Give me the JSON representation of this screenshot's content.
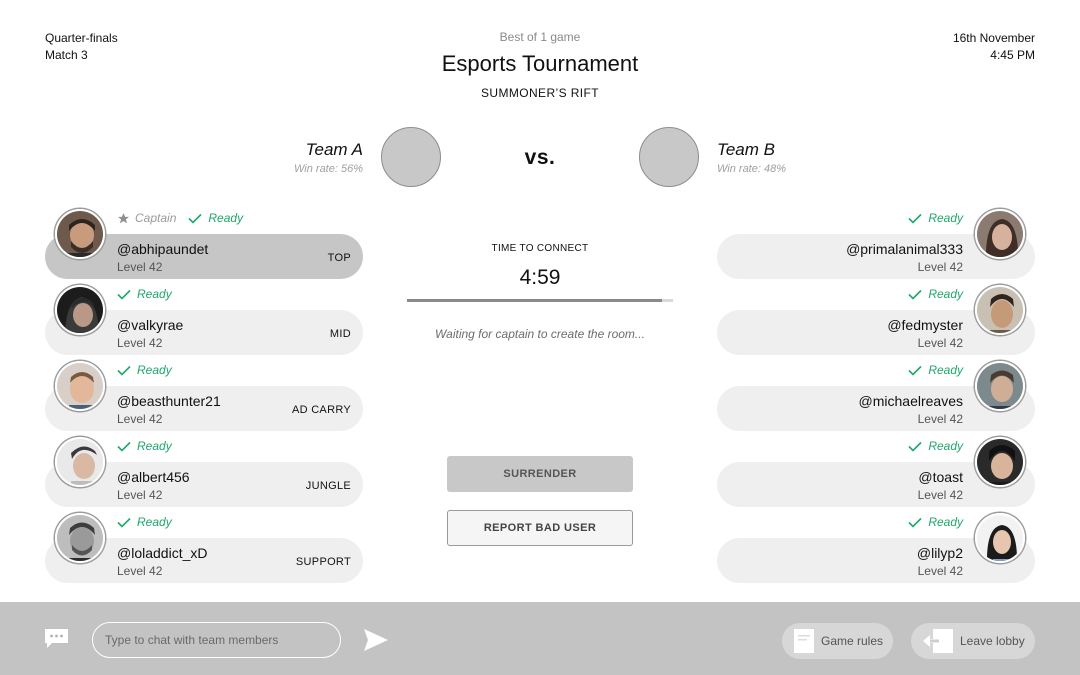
{
  "match": {
    "stage": "Quarter-finals",
    "match_number": "Match 3"
  },
  "header": {
    "format": "Best of 1 game",
    "title": "Esports Tournament",
    "map": "SUMMONER’S RIFT"
  },
  "schedule": {
    "date": "16th November",
    "time": "4:45 PM"
  },
  "versus": "vs.",
  "team_a": {
    "name": "Team A",
    "win_rate": "Win rate: 56%"
  },
  "team_b": {
    "name": "Team B",
    "win_rate": "Win rate: 48%"
  },
  "team_a_players": [
    {
      "captain_label": "Captain",
      "status": "Ready",
      "handle": "@abhipaundet",
      "level": "Level 42",
      "role": "TOP",
      "active": true
    },
    {
      "status": "Ready",
      "handle": "@valkyrae",
      "level": "Level 42",
      "role": "MID"
    },
    {
      "status": "Ready",
      "handle": "@beasthunter21",
      "level": "Level 42",
      "role": "AD CARRY"
    },
    {
      "status": "Ready",
      "handle": "@albert456",
      "level": "Level 42",
      "role": "JUNGLE"
    },
    {
      "status": "Ready",
      "handle": "@loladdict_xD",
      "level": "Level 42",
      "role": "SUPPORT"
    }
  ],
  "team_b_players": [
    {
      "status": "Ready",
      "handle": "@primalanimal333",
      "level": "Level 42"
    },
    {
      "status": "Ready",
      "handle": "@fedmyster",
      "level": "Level 42"
    },
    {
      "status": "Ready",
      "handle": "@michaelreaves",
      "level": "Level 42"
    },
    {
      "status": "Ready",
      "handle": "@toast",
      "level": "Level 42"
    },
    {
      "status": "Ready",
      "handle": "@lilyp2",
      "level": "Level 42"
    }
  ],
  "connect": {
    "label": "TIME TO CONNECT",
    "timer": "4:59",
    "progress": 0.96,
    "waiting": "Waiting for captain to create the room..."
  },
  "actions": {
    "surrender": "SURRENDER",
    "report": "REPORT BAD USER"
  },
  "footer": {
    "chat_placeholder": "Type to chat with team members",
    "game_rules": "Game rules",
    "leave_lobby": "Leave lobby"
  },
  "colors": {
    "ready": "#1ea86a",
    "captain": "#9a9a9a",
    "footer_bg": "#c3c3c3",
    "active_row": "#c6c6c6",
    "row": "#efefef"
  },
  "icons": {
    "captain": "star-icon",
    "ready": "checkmark-icon",
    "chat": "chat-bubble-icon",
    "send": "send-icon",
    "rules": "document-icon",
    "leave": "exit-arrow-icon"
  }
}
